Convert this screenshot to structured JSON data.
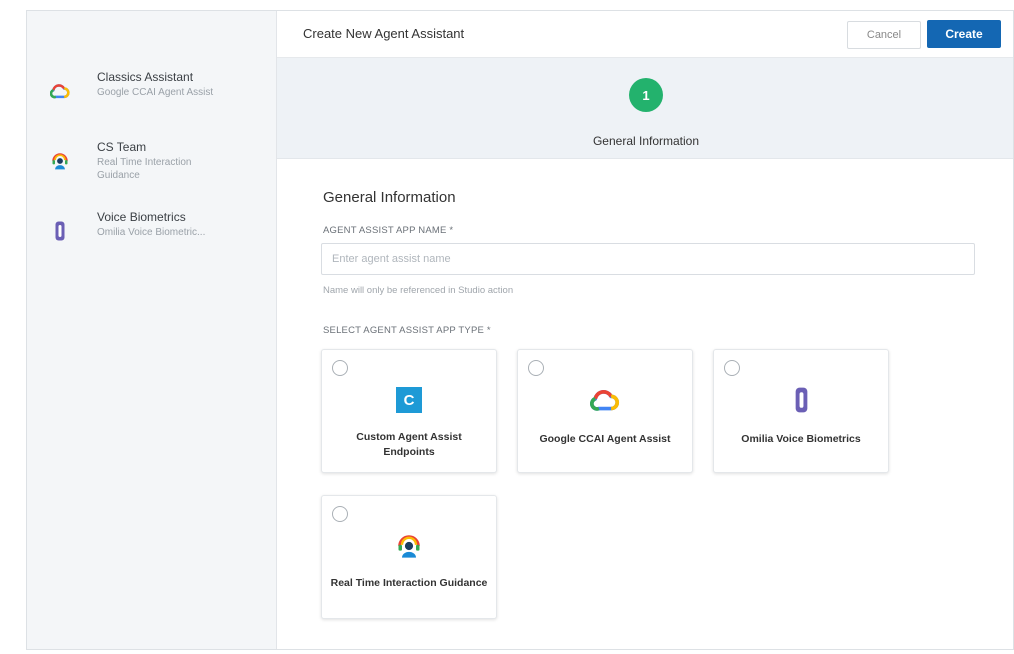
{
  "sidebar": {
    "items": [
      {
        "title": "Classics Assistant",
        "subtitle": "Google CCAI Agent Assist",
        "icon": "google-cloud-icon"
      },
      {
        "title": "CS Team",
        "subtitle": "Real Time Interaction Guidance",
        "icon": "headset-agent-icon"
      },
      {
        "title": "Voice Biometrics",
        "subtitle": "Omilia Voice Biometric...",
        "icon": "omilia-icon"
      }
    ]
  },
  "header": {
    "title": "Create New Agent Assistant",
    "cancel_label": "Cancel",
    "create_label": "Create"
  },
  "stepper": {
    "step_number": "1",
    "step_label": "General Information"
  },
  "form": {
    "section_title": "General Information",
    "name_label": "AGENT ASSIST APP NAME *",
    "name_placeholder": "Enter agent assist name",
    "name_value": "",
    "name_help": "Name will only be referenced in Studio action",
    "type_label": "SELECT AGENT ASSIST APP TYPE *",
    "types": [
      {
        "label": "Custom Agent Assist Endpoints",
        "icon": "custom-c-icon",
        "selected": false
      },
      {
        "label": "Google CCAI Agent Assist",
        "icon": "google-cloud-icon",
        "selected": false
      },
      {
        "label": "Omilia Voice Biometrics",
        "icon": "omilia-icon",
        "selected": false
      },
      {
        "label": "Real Time Interaction Guidance",
        "icon": "headset-agent-icon",
        "selected": false
      }
    ]
  },
  "colors": {
    "primary": "#1467b3",
    "step_green": "#23b26d",
    "custom_icon": "#1e9ad6",
    "omilia_icon": "#6b5fb5"
  }
}
